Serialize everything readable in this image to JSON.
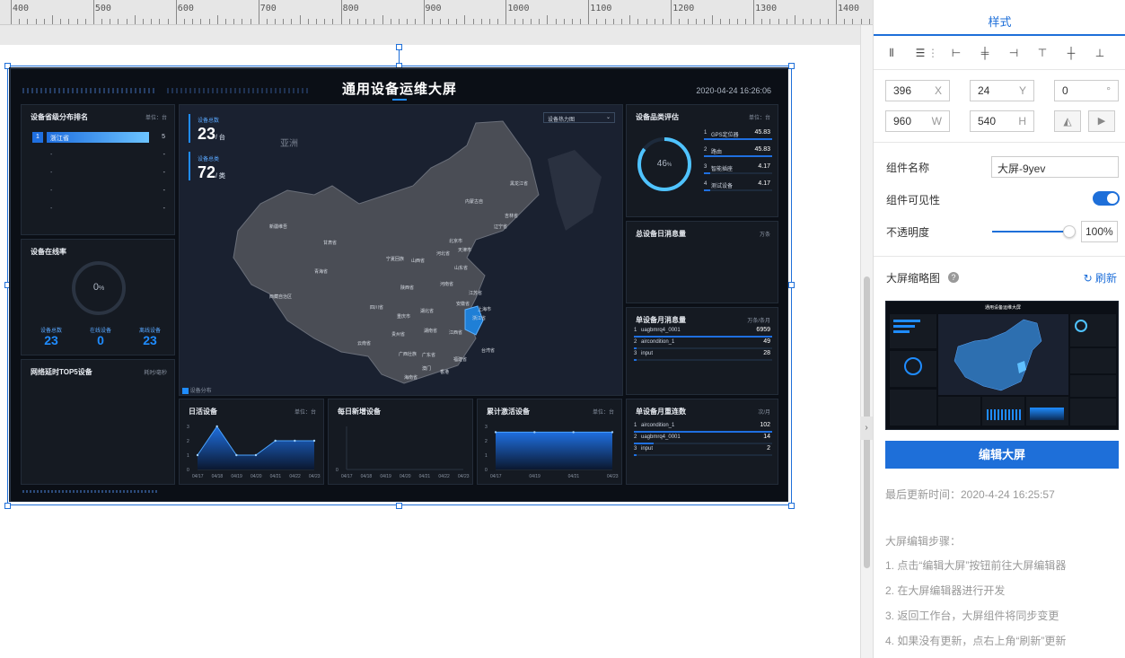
{
  "ruler": {
    "labels": [
      "400",
      "500",
      "600",
      "700",
      "800",
      "900",
      "1000",
      "1100",
      "1200",
      "1300",
      "1400"
    ]
  },
  "dashboard": {
    "title": "通用设备运维大屏",
    "datetime": "2020-04-24 16:26:06",
    "region_rank": {
      "title": "设备省级分布排名",
      "unit": "单位：台",
      "items": [
        {
          "rank": "1",
          "name": "浙江省",
          "value": "5"
        },
        {
          "rank": "",
          "name": "-",
          "value": "-"
        },
        {
          "rank": "",
          "name": "-",
          "value": "-"
        },
        {
          "rank": "",
          "name": "-",
          "value": "-"
        },
        {
          "rank": "",
          "name": "-",
          "value": "-"
        }
      ]
    },
    "online_rate": {
      "title": "设备在线率",
      "percent": "0",
      "percent_unit": "%",
      "stats": [
        {
          "label": "设备总数",
          "value": "23"
        },
        {
          "label": "在线设备",
          "value": "0"
        },
        {
          "label": "离线设备",
          "value": "23"
        }
      ]
    },
    "latency": {
      "title": "网络延时TOP5设备",
      "unit": "耗时/毫秒"
    },
    "map": {
      "device_total_label": "设备总数",
      "device_total": "23",
      "device_total_unit": "/ 台",
      "device_types_label": "设备总类",
      "device_types": "72",
      "device_types_unit": "/ 类",
      "dropdown": "设备热力图",
      "continent": "亚洲",
      "legend": "设备分布",
      "provinces": [
        "新疆维吾尔自治区",
        "西藏自治区",
        "青海省",
        "甘肃省",
        "内蒙古自治区",
        "黑龙江省",
        "吉林省",
        "辽宁省",
        "北京市",
        "天津市",
        "河北省",
        "山西省",
        "山东省",
        "宁夏回族自治区",
        "陕西省",
        "河南省",
        "江苏省",
        "上海市",
        "安徽省",
        "湖北省",
        "四川省",
        "重庆市",
        "浙江省",
        "湖南省",
        "江西省",
        "贵州省",
        "云南省",
        "广西壮族自治区",
        "广东省",
        "福建省",
        "台湾省",
        "海南省",
        "香港",
        "澳门"
      ]
    },
    "category_eval": {
      "title": "设备品类评估",
      "unit": "单位：台",
      "gauge": "46",
      "gauge_unit": "%",
      "items": [
        {
          "rank": "1",
          "name": "GPS定位器",
          "value": "45.83",
          "pct": 100
        },
        {
          "rank": "2",
          "name": "路由",
          "value": "45.83",
          "pct": 100
        },
        {
          "rank": "3",
          "name": "智能插座",
          "value": "4.17",
          "pct": 9
        },
        {
          "rank": "4",
          "name": "测试设备",
          "value": "4.17",
          "pct": 9
        }
      ]
    },
    "daily_msg": {
      "title": "总设备日消息量",
      "unit": "万条"
    },
    "monthly_msg": {
      "title": "单设备月消息量",
      "unit": "万条/条月",
      "items": [
        {
          "rank": "1",
          "name": "uagbmrq4_0001",
          "value": "6959",
          "pct": 100
        },
        {
          "rank": "2",
          "name": "aircondition_1",
          "value": "49",
          "pct": 2
        },
        {
          "rank": "3",
          "name": "input",
          "value": "28",
          "pct": 1
        }
      ]
    },
    "monthly_reconnect": {
      "title": "单设备月重连数",
      "unit": "次/月",
      "items": [
        {
          "rank": "1",
          "name": "aircondition_1",
          "value": "102",
          "pct": 100
        },
        {
          "rank": "2",
          "name": "uagbmrq4_0001",
          "value": "14",
          "pct": 14
        },
        {
          "rank": "3",
          "name": "input",
          "value": "2",
          "pct": 2
        }
      ]
    },
    "daily_active": {
      "title": "日活设备",
      "unit": "单位：台",
      "yticks": [
        "3",
        "2",
        "1",
        "0"
      ],
      "xticks": [
        "04/17",
        "04/18",
        "04/19",
        "04/20",
        "04/21",
        "04/22",
        "04/23"
      ]
    },
    "daily_new": {
      "title": "每日新增设备",
      "yticks": [
        "0"
      ],
      "xticks": [
        "04/17",
        "04/18",
        "04/19",
        "04/20",
        "04/21",
        "04/22",
        "04/23"
      ]
    },
    "activated": {
      "title": "累计激活设备",
      "unit": "单位：台",
      "yticks": [
        "3",
        "2",
        "1",
        "0"
      ],
      "xticks": [
        "04/17",
        "04/19",
        "04/21",
        "04/23"
      ]
    }
  },
  "chart_data": [
    {
      "type": "area",
      "title": "日活设备",
      "categories": [
        "04/17",
        "04/18",
        "04/19",
        "04/20",
        "04/21",
        "04/22",
        "04/23"
      ],
      "values": [
        1,
        3,
        1,
        1,
        2,
        2,
        2
      ],
      "ylim": [
        0,
        3
      ]
    },
    {
      "type": "line",
      "title": "每日新增设备",
      "categories": [
        "04/17",
        "04/18",
        "04/19",
        "04/20",
        "04/21",
        "04/22",
        "04/23"
      ],
      "values": [
        0,
        0,
        0,
        0,
        0,
        0,
        0
      ]
    },
    {
      "type": "area",
      "title": "累计激活设备",
      "categories": [
        "04/17",
        "04/19",
        "04/21",
        "04/23"
      ],
      "values": [
        2.6,
        2.6,
        2.6,
        2.6
      ],
      "ylim": [
        0,
        3
      ]
    }
  ],
  "sidebar": {
    "tab": "样式",
    "x": "396",
    "x_label": "X",
    "y": "24",
    "y_label": "Y",
    "rotation": "0",
    "rotation_unit": "°",
    "w": "960",
    "w_label": "W",
    "h": "540",
    "h_label": "H",
    "name_label": "组件名称",
    "name_value": "大屏-9yev",
    "visible_label": "组件可见性",
    "opacity_label": "不透明度",
    "opacity_value": "100%",
    "opacity_fraction": 1,
    "thumb_label": "大屏缩略图",
    "help_icon": "?",
    "refresh_label": "刷新",
    "edit_button": "编辑大屏",
    "last_updated": "最后更新时间：2020-4-24 16:25:57",
    "steps_title": "大屏编辑步骤：",
    "steps": [
      "1. 点击“编辑大屏”按钮前往大屏编辑器",
      "2. 在大屏编辑器进行开发",
      "3. 返回工作台，大屏组件将同步变更",
      "4. 如果没有更新，点右上角“刷新”更新"
    ]
  }
}
